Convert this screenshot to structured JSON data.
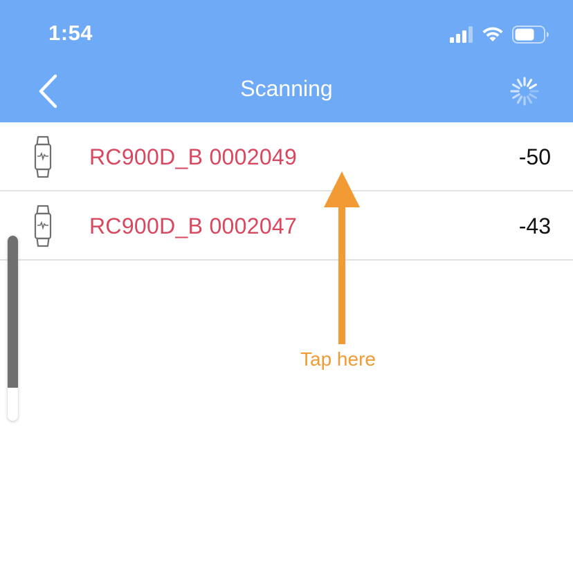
{
  "status_bar": {
    "time": "1:54",
    "icons": [
      "signal-icon",
      "wifi-icon",
      "battery-icon"
    ]
  },
  "nav": {
    "back_icon": "chevron-left-icon",
    "title": "Scanning",
    "activity_icon": "spinner-icon"
  },
  "devices": [
    {
      "icon": "wristband-icon",
      "name": "RC900D_B 0002049",
      "rssi": "-50"
    },
    {
      "icon": "wristband-icon",
      "name": "RC900D_B 0002047",
      "rssi": "-43"
    }
  ],
  "scroll": {
    "position_fraction": 0.82
  },
  "annotation": {
    "text": "Tap here",
    "icon": "up-arrow-icon"
  },
  "colors": {
    "header_bg": "#6eaaf5",
    "device_name": "#d9475f",
    "annotation": "#f29a33",
    "divider": "#e3e3e3"
  }
}
